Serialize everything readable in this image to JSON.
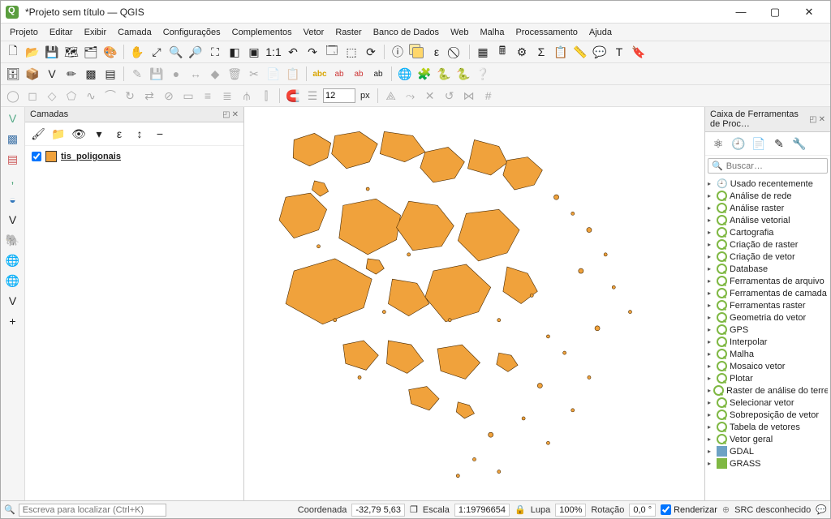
{
  "window": {
    "title": "*Projeto sem título — QGIS"
  },
  "menu": [
    "Projeto",
    "Editar",
    "Exibir",
    "Camada",
    "Configurações",
    "Complementos",
    "Vetor",
    "Raster",
    "Banco de Dados",
    "Web",
    "Malha",
    "Processamento",
    "Ajuda"
  ],
  "snap_value": "12",
  "snap_unit": "px",
  "layers_panel": {
    "title": "Camadas",
    "layer": {
      "checked": true,
      "name": "tis_poligonais",
      "color": "#f0a23c"
    }
  },
  "processing_panel": {
    "title": "Caixa de Ferramentas de Proc…",
    "search_placeholder": "Buscar…",
    "nodes": [
      {
        "icon": "clock",
        "label": "Usado recentemente"
      },
      {
        "icon": "q",
        "label": "Análise de rede"
      },
      {
        "icon": "q",
        "label": "Análise raster"
      },
      {
        "icon": "q",
        "label": "Análise vetorial"
      },
      {
        "icon": "q",
        "label": "Cartografia"
      },
      {
        "icon": "q",
        "label": "Criação de raster"
      },
      {
        "icon": "q",
        "label": "Criação de vetor"
      },
      {
        "icon": "q",
        "label": "Database"
      },
      {
        "icon": "q",
        "label": "Ferramentas de arquivo"
      },
      {
        "icon": "q",
        "label": "Ferramentas de camada"
      },
      {
        "icon": "q",
        "label": "Ferramentas raster"
      },
      {
        "icon": "q",
        "label": "Geometria do vetor"
      },
      {
        "icon": "q",
        "label": "GPS"
      },
      {
        "icon": "q",
        "label": "Interpolar"
      },
      {
        "icon": "q",
        "label": "Malha"
      },
      {
        "icon": "q",
        "label": "Mosaico vetor"
      },
      {
        "icon": "q",
        "label": "Plotar"
      },
      {
        "icon": "q",
        "label": "Raster de análise do terreno"
      },
      {
        "icon": "q",
        "label": "Selecionar vetor"
      },
      {
        "icon": "q",
        "label": "Sobreposição de vetor"
      },
      {
        "icon": "q",
        "label": "Tabela de vetores"
      },
      {
        "icon": "q",
        "label": "Vetor geral"
      },
      {
        "icon": "gdal",
        "label": "GDAL"
      },
      {
        "icon": "grass",
        "label": "GRASS"
      }
    ]
  },
  "statusbar": {
    "locator_placeholder": "Escreva para localizar (Ctrl+K)",
    "coord_label": "Coordenada",
    "coord_value": "-32,79 5,63",
    "scale_label": "Escala",
    "scale_value": "1:19796654",
    "lupa_label": "Lupa",
    "lupa_value": "100%",
    "rot_label": "Rotação",
    "rot_value": "0,0 °",
    "render_label": "Renderizar",
    "render_checked": true,
    "crs_label": "SRC desconhecido"
  }
}
